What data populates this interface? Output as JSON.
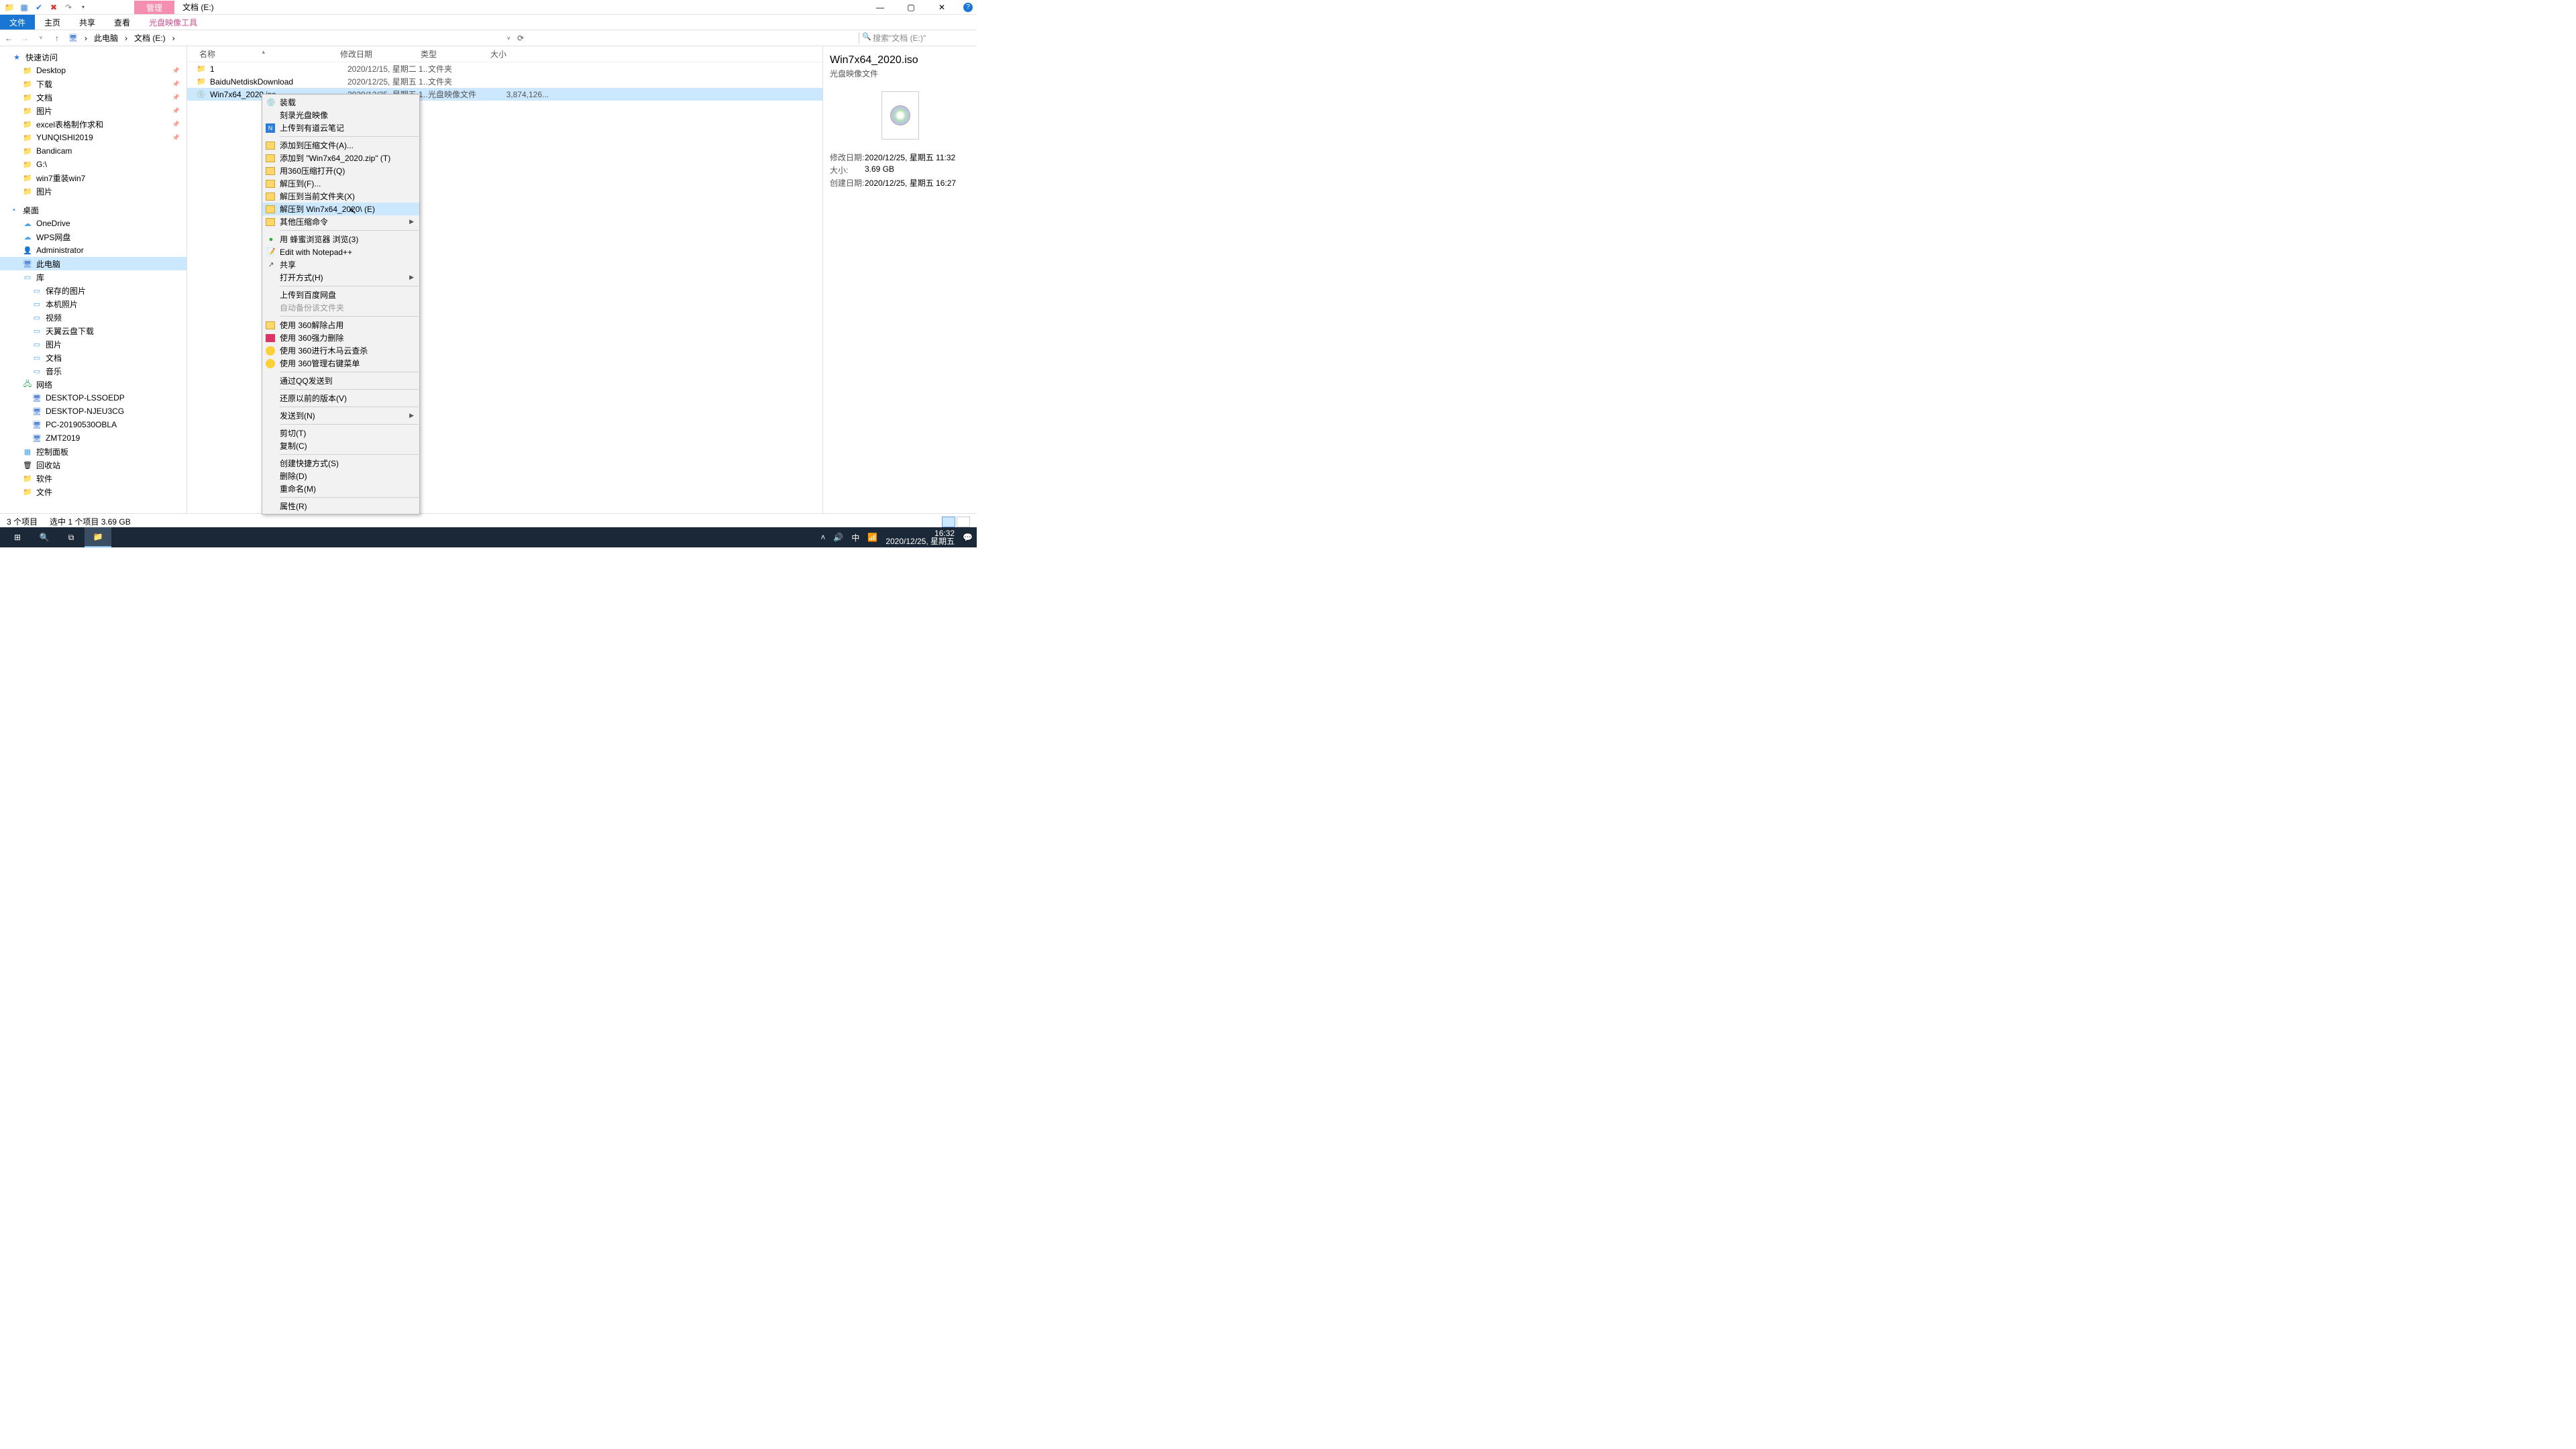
{
  "window": {
    "title_tab": "管理",
    "location": "文档 (E:)"
  },
  "ribbon": {
    "file": "文件",
    "home": "主页",
    "share": "共享",
    "view": "查看",
    "disc_tools": "光盘映像工具"
  },
  "address": {
    "this_pc": "此电脑",
    "folder": "文档 (E:)",
    "search_placeholder": "搜索\"文档 (E:)\""
  },
  "columns": {
    "name": "名称",
    "date": "修改日期",
    "type": "类型",
    "size": "大小"
  },
  "rows": [
    {
      "name": "1",
      "date": "2020/12/15, 星期二 1...",
      "type": "文件夹",
      "size": "",
      "icon": "folder"
    },
    {
      "name": "BaiduNetdiskDownload",
      "date": "2020/12/25, 星期五 1...",
      "type": "文件夹",
      "size": "",
      "icon": "folder"
    },
    {
      "name": "Win7x64_2020.iso",
      "date": "2020/12/25, 星期五 1...",
      "type": "光盘映像文件",
      "size": "3,874,126...",
      "icon": "disc",
      "selected": true
    }
  ],
  "tree": {
    "quick": "快速访问",
    "quick_items": [
      "Desktop",
      "下载",
      "文档",
      "图片",
      "excel表格制作求和",
      "YUNQISHI2019",
      "Bandicam",
      "G:\\",
      "win7重装win7",
      "图片"
    ],
    "desktop": "桌面",
    "desktop_items": [
      "OneDrive",
      "WPS网盘",
      "Administrator",
      "此电脑",
      "库"
    ],
    "lib_items": [
      "保存的图片",
      "本机照片",
      "视频",
      "天翼云盘下载",
      "图片",
      "文档",
      "音乐"
    ],
    "network": "网络",
    "net_items": [
      "DESKTOP-LSSOEDP",
      "DESKTOP-NJEU3CG",
      "PC-20190530OBLA",
      "ZMT2019"
    ],
    "cp": "控制面板",
    "recycle": "回收站",
    "soft": "软件",
    "files": "文件"
  },
  "details": {
    "title": "Win7x64_2020.iso",
    "subtitle": "光盘映像文件",
    "mod_label": "修改日期:",
    "mod_val": "2020/12/25, 星期五 11:32",
    "size_label": "大小:",
    "size_val": "3.69 GB",
    "create_label": "创建日期:",
    "create_val": "2020/12/25, 星期五 16:27"
  },
  "status": {
    "count": "3 个项目",
    "selected": "选中 1 个项目  3.69 GB"
  },
  "context_menu": [
    {
      "label": "装载",
      "icon": "disc-mount"
    },
    {
      "label": "刻录光盘映像"
    },
    {
      "label": "上传到有道云笔记",
      "icon": "blue-sq"
    },
    {
      "sep": true
    },
    {
      "label": "添加到压缩文件(A)...",
      "icon": "box"
    },
    {
      "label": "添加到 \"Win7x64_2020.zip\" (T)",
      "icon": "box"
    },
    {
      "label": "用360压缩打开(Q)",
      "icon": "box"
    },
    {
      "label": "解压到(F)...",
      "icon": "box"
    },
    {
      "label": "解压到当前文件夹(X)",
      "icon": "box"
    },
    {
      "label": "解压到 Win7x64_2020\\ (E)",
      "icon": "box",
      "hov": true
    },
    {
      "label": "其他压缩命令",
      "icon": "box",
      "submenu": true
    },
    {
      "sep": true
    },
    {
      "label": "用 蜂蜜浏览器 浏览(3)",
      "icon": "green-dot"
    },
    {
      "label": "Edit with Notepad++",
      "icon": "npp"
    },
    {
      "label": "共享",
      "icon": "share"
    },
    {
      "label": "打开方式(H)",
      "submenu": true
    },
    {
      "sep": true
    },
    {
      "label": "上传到百度网盘"
    },
    {
      "label": "自动备份该文件夹",
      "disabled": true
    },
    {
      "sep": true
    },
    {
      "label": "使用 360解除占用",
      "icon": "box"
    },
    {
      "label": "使用 360强力删除",
      "icon": "del360"
    },
    {
      "label": "使用 360进行木马云查杀",
      "icon": "green-c"
    },
    {
      "label": "使用 360管理右键菜单",
      "icon": "green-c"
    },
    {
      "sep": true
    },
    {
      "label": "通过QQ发送到"
    },
    {
      "sep": true
    },
    {
      "label": "还原以前的版本(V)"
    },
    {
      "sep": true
    },
    {
      "label": "发送到(N)",
      "submenu": true
    },
    {
      "sep": true
    },
    {
      "label": "剪切(T)"
    },
    {
      "label": "复制(C)"
    },
    {
      "sep": true
    },
    {
      "label": "创建快捷方式(S)"
    },
    {
      "label": "删除(D)"
    },
    {
      "label": "重命名(M)"
    },
    {
      "sep": true
    },
    {
      "label": "属性(R)"
    }
  ],
  "taskbar": {
    "time": "16:32",
    "date": "2020/12/25, 星期五",
    "ime": "中"
  }
}
